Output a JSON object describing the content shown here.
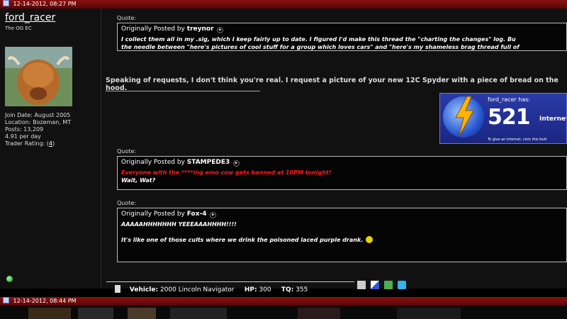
{
  "post_header": {
    "date": "12-14-2012, 08:27 PM"
  },
  "user": {
    "name": "ford_racer",
    "title": "The OG EC",
    "join_date": "Join Date: August 2005",
    "location": "Location: Bozeman, MT",
    "posts": "Posts: 13,209",
    "per_day": "4.91 per day",
    "trader_label": "Trader Rating: (",
    "trader_value": "4",
    "trader_close": ")"
  },
  "quotes": [
    {
      "label": "Quote:",
      "prefix": "Originally Posted by",
      "author": "treynor",
      "lines": [
        "I collect them all in my .sig, which I keep fairly up to date. I figured I'd make this thread the \"charting the changes\" log. Bu",
        "the needle between \"here's pictures of cool stuff for a group which loves cars\" and \"here's my shameless brag thread full of"
      ]
    },
    {
      "label": "Quote:",
      "prefix": "Originally Posted by",
      "author": "STAMPEDE3",
      "lines": [
        "Everyone with the ****ing emo cow gets banned at 10PM tonight!",
        "Wait, Wat?"
      ]
    },
    {
      "label": "Quote:",
      "prefix": "Originally Posted by",
      "author": "Fox-4",
      "lines": [
        "AAAAAHHHHHHH YEEEAAAHHHH!!!!",
        "",
        "It's like one of those cults where we drink the poisoned laced purple drank."
      ]
    }
  ],
  "body_text": "Speaking of requests, I don't think you're real. I request a picture of your new 12C Spyder with a piece of bread on the hood.",
  "badge": {
    "name": "ford_racer has:",
    "number": "521",
    "unit": "Internets",
    "caption": "To give an internet, click this butt"
  },
  "signature": {
    "vehicle_label": "Vehicle:",
    "vehicle_value": "2000 Lincoln Navigator",
    "hp_label": "HP:",
    "hp_value": "300",
    "tq_label": "TQ:",
    "tq_value": "355"
  },
  "next_post_header": {
    "date": "12-14-2012, 08:44 PM"
  },
  "colors": {
    "header_red": "#8a1010",
    "quote_red": "#ff1a1a",
    "badge_blue": "#2a3aa8",
    "online_green": "#1a8a1a"
  }
}
